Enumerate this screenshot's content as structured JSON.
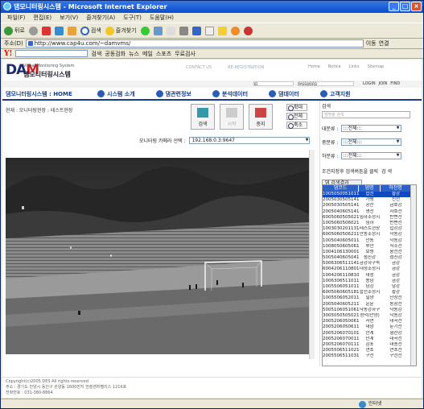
{
  "window": {
    "title": "댐모니터링시스템 - Microsoft Internet Explorer"
  },
  "menu": [
    "파일(F)",
    "편집(E)",
    "보기(V)",
    "즐겨찾기(A)",
    "도구(T)",
    "도움말(H)"
  ],
  "toolbar": {
    "back": "뒤로",
    "search": "검색",
    "favorites": "즐겨찾기"
  },
  "address": {
    "label": "주소(D)",
    "url": "http://www.cap4u.com/~damvms/",
    "go": "이동",
    "links": "연결"
  },
  "yahoo": {
    "logo": "Y!",
    "search_btn": "검색",
    "items": [
      "공동검화",
      "뉴스",
      "메일",
      "스포츠",
      "무료검사"
    ]
  },
  "header": {
    "logo_dam": "DA",
    "logo_m": "M",
    "sub_en": "Visual Monitoring System",
    "sub_kr": "댐모니터링시스템",
    "links": [
      "CONTACT US",
      "RE-REGISTRATION"
    ],
    "nav": [
      "Home",
      "Notice",
      "Links",
      "Sitemap"
    ],
    "login_links": [
      "LOGIN",
      "JOIN",
      "FIND"
    ],
    "id_placeholder": "ID",
    "pw_placeholder": "PASSWORD"
  },
  "navbar": {
    "home": "댐모니터링시스템 : HOME",
    "items": [
      "시스템 소개",
      "댐관련정보",
      "분석데이터",
      "댐데이터",
      "고객지원"
    ]
  },
  "main": {
    "breadcrumb": "현재 : 모니터링현장 : 테스트현장",
    "buttons": {
      "search": "검색",
      "start": "시작",
      "stop": "중지"
    },
    "zoom": {
      "in": "확대",
      "all": "전체",
      "out": "축소"
    },
    "camera_label": "모니터링 카메라 선택 :",
    "camera_value": "192.168.0.3:9647"
  },
  "right": {
    "search_title": "검색",
    "search_placeholder": "댐명을 검색",
    "large_label": "대분류 :",
    "mid_label": "중분류 :",
    "small_label": "하분류 :",
    "select_all": ":::전체:::",
    "hint": "조건지정후 검색버튼을 클릭",
    "search_btn": "검 색",
    "result_tab": "댐 검색결과",
    "columns": [
      "댐코드",
      "댐명",
      "하천명"
    ],
    "rows": [
      [
        "1005050051011000",
        "합천",
        "황강"
      ],
      [
        "2005030505141000",
        "가평",
        "신천"
      ],
      [
        "2005030505141000",
        "공산",
        "금호강"
      ],
      [
        "2005040605141000",
        "영천",
        "자호천"
      ],
      [
        "6005060505021000",
        "임하조정지",
        "반변천"
      ],
      [
        "1005060506021000",
        "임하",
        "반변천"
      ],
      [
        "1003030201131013",
        "테스트현장",
        "입강강"
      ],
      [
        "6005060506211000",
        "안동조정지",
        "낙동강"
      ],
      [
        "1005040605011000",
        "안동",
        "낙동강"
      ],
      [
        "1008050605061000",
        "부안",
        "직소천"
      ],
      [
        "1004106130001000",
        "보령",
        "웅천천"
      ],
      [
        "5005040605041000",
        "섬진강",
        "섬진강"
      ],
      [
        "5006306511141000",
        "금강하구둑",
        "금강"
      ],
      [
        "6004206110801000",
        "대청조정지",
        "금강"
      ],
      [
        "1004206110810000",
        "대청",
        "금강"
      ],
      [
        "1006306511011000",
        "용담",
        "금강"
      ],
      [
        "1005506051011000",
        "남강",
        "남강"
      ],
      [
        "6005060605181000",
        "합천조정지",
        "황강"
      ],
      [
        "1005506052011000",
        "밀양",
        "단장천"
      ],
      [
        "2005040605211000",
        "운문",
        "동창천"
      ],
      [
        "5005106051061000",
        "낙동강하구",
        "낙동강"
      ],
      [
        "3005050505021000",
        "성덕(안양)",
        "낙동강"
      ],
      [
        "2005206050061000",
        "사연",
        "대곡천"
      ],
      [
        "2005206050611000",
        "대암",
        "둔기천"
      ],
      [
        "2005206070101000",
        "안계",
        "형산강"
      ],
      [
        "2005206070011000",
        "안계",
        "대곡천"
      ],
      [
        "2005206070111000",
        "감포",
        "대종천"
      ],
      [
        "2005506511021000",
        "연초",
        "연초천"
      ],
      [
        "2005506511031000",
        "구천",
        "구천천"
      ]
    ]
  },
  "footer": {
    "line1": "Copyright(c)2005 DES All rights reserved",
    "line2": "주소 : 경기도 안양시 동안구 관양동 1600번지 한솔벤처팰리스 1216호",
    "line3": "전화번호 : 031-380-8864"
  },
  "status": {
    "zone": "인터넷"
  },
  "colors": {
    "title_blue": "#0a4ed0",
    "nav_blue": "#1a3b8b",
    "table_head": "#2c62c8",
    "selected_row": "#1048c0"
  }
}
